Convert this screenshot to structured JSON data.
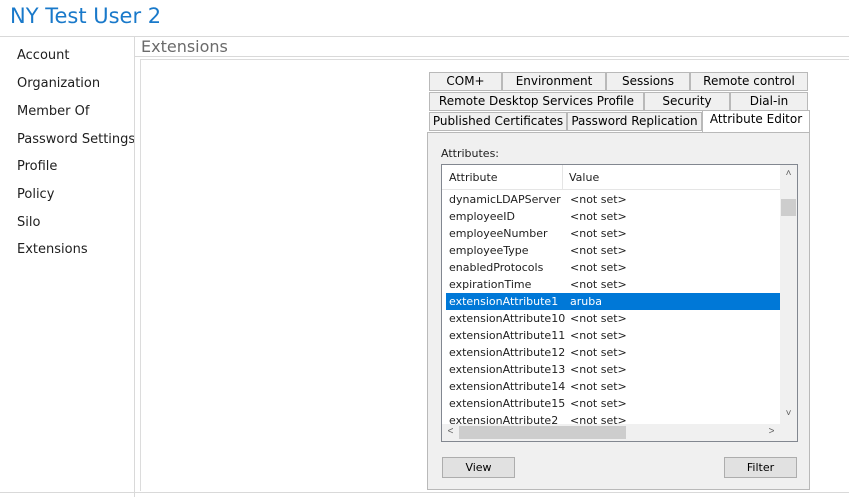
{
  "window": {
    "title": "NY Test User 2"
  },
  "sidebar": {
    "items": [
      {
        "label": "Account"
      },
      {
        "label": "Organization"
      },
      {
        "label": "Member Of"
      },
      {
        "label": "Password Settings"
      },
      {
        "label": "Profile"
      },
      {
        "label": "Policy"
      },
      {
        "label": "Silo"
      },
      {
        "label": "Extensions"
      }
    ]
  },
  "main": {
    "section_title": "Extensions"
  },
  "tabs": {
    "row1": [
      "COM+",
      "Environment",
      "Sessions",
      "Remote control"
    ],
    "row2": [
      "Remote Desktop Services Profile",
      "Security",
      "Dial-in"
    ],
    "row3": [
      "Published Certificates",
      "Password Replication",
      "Attribute Editor"
    ],
    "active": "Attribute Editor"
  },
  "attribute_editor": {
    "list_label": "Attributes:",
    "columns": [
      "Attribute",
      "Value"
    ],
    "rows": [
      {
        "attribute": "dynamicLDAPServer",
        "value": "<not set>"
      },
      {
        "attribute": "employeeID",
        "value": "<not set>"
      },
      {
        "attribute": "employeeNumber",
        "value": "<not set>"
      },
      {
        "attribute": "employeeType",
        "value": "<not set>"
      },
      {
        "attribute": "enabledProtocols",
        "value": "<not set>"
      },
      {
        "attribute": "expirationTime",
        "value": "<not set>"
      },
      {
        "attribute": "extensionAttribute1",
        "value": "aruba",
        "selected": true
      },
      {
        "attribute": "extensionAttribute10",
        "value": "<not set>"
      },
      {
        "attribute": "extensionAttribute11",
        "value": "<not set>"
      },
      {
        "attribute": "extensionAttribute12",
        "value": "<not set>"
      },
      {
        "attribute": "extensionAttribute13",
        "value": "<not set>"
      },
      {
        "attribute": "extensionAttribute14",
        "value": "<not set>"
      },
      {
        "attribute": "extensionAttribute15",
        "value": "<not set>"
      },
      {
        "attribute": "extensionAttribute2",
        "value": "<not set>"
      }
    ],
    "view_button": "View",
    "filter_button": "Filter"
  },
  "colors": {
    "title": "#1979ca",
    "selection": "#0078d7"
  }
}
